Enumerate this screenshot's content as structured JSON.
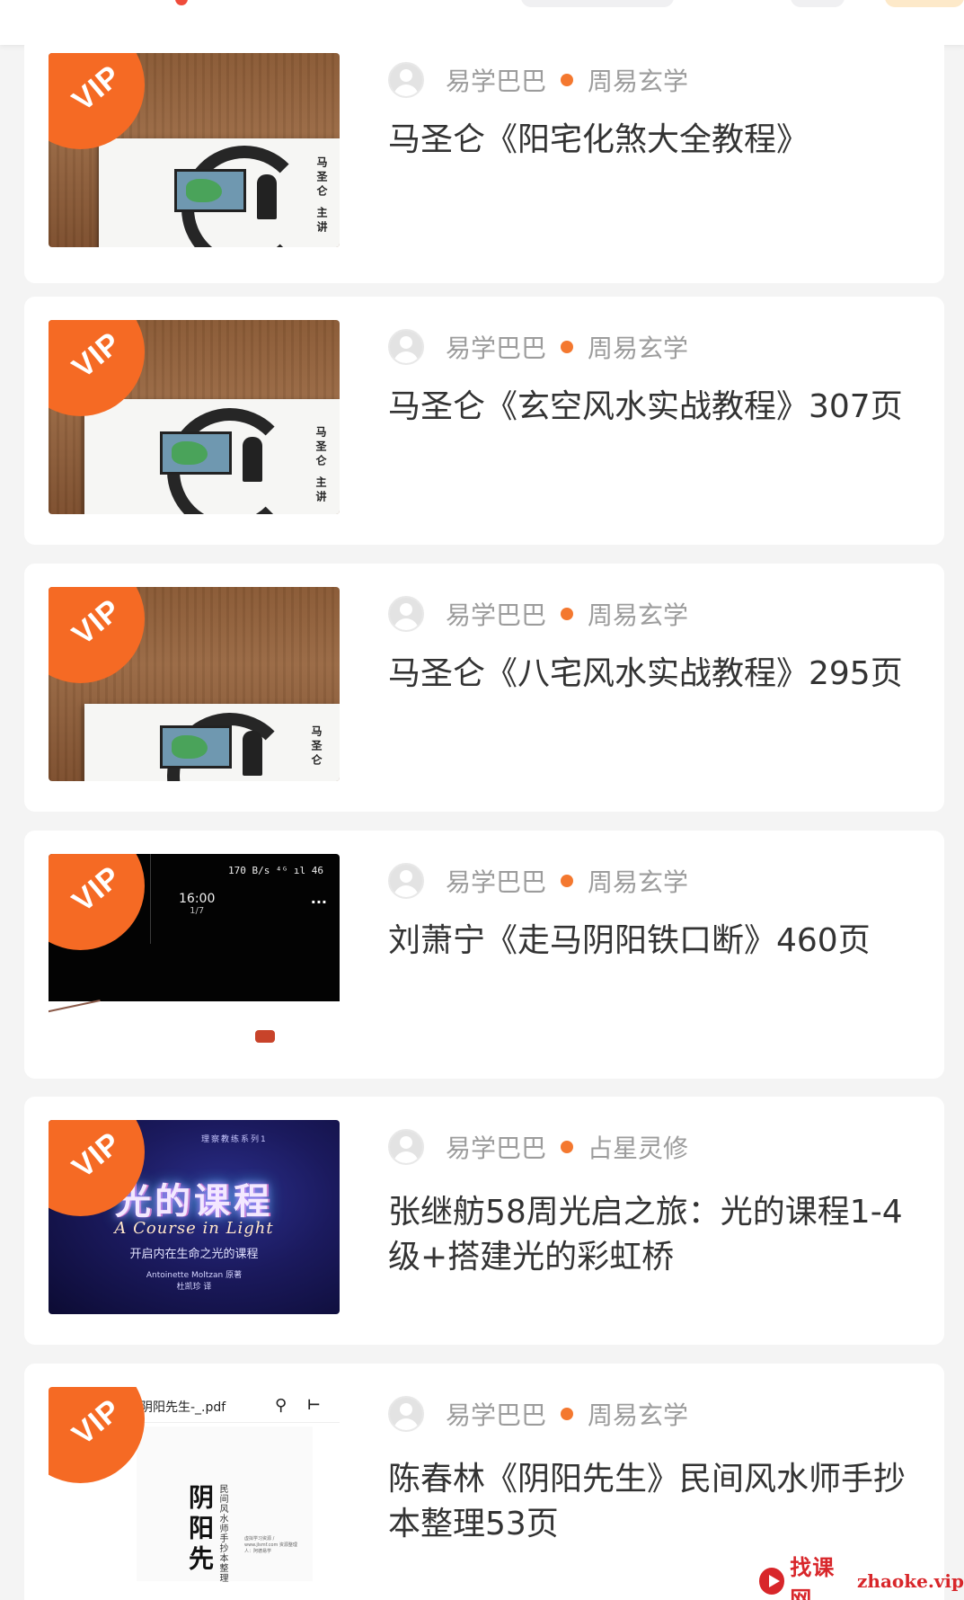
{
  "vip_label": "VIP",
  "cards": [
    {
      "author": "易学巴巴",
      "category": "周易玄学",
      "title": "马圣仑《阳宅化煞大全教程》",
      "cover": {
        "vertical_text": "马圣仑 主讲"
      }
    },
    {
      "author": "易学巴巴",
      "category": "周易玄学",
      "title": "马圣仑《玄空风水实战教程》307页",
      "cover": {
        "vertical_text": "马圣仑 主讲"
      }
    },
    {
      "author": "易学巴巴",
      "category": "周易玄学",
      "title": "马圣仑《八宅风水实战教程》295页",
      "cover": {
        "vertical_text": "马圣仑"
      }
    },
    {
      "author": "易学巴巴",
      "category": "周易玄学",
      "title": "刘萧宁《走马阴阳铁口断》460页",
      "cover": {
        "status": "170 B/s  ⁴ᴳ ıl 46",
        "time": "16:00",
        "page": "1/7",
        "menu": "···"
      }
    },
    {
      "author": "易学巴巴",
      "category": "占星灵修",
      "title": "张继舫58周光启之旅：光的课程1-4级+搭建光的彩虹桥",
      "cover": {
        "top": "理察教练系列1",
        "title": "光的课程",
        "en": "A Course in Light",
        "sub": "开启内在生命之光的课程",
        "author": "Antoinette Moltzan 原著",
        "translator": "杜凯珍 译"
      }
    },
    {
      "author": "易学巴巴",
      "category": "周易玄学",
      "title": "陈春林《阴阳先生》民间风水师手抄本整理53页",
      "cover": {
        "filename": "阴阳先生-_.pdf",
        "big": "阴阳先",
        "small": "民间风水师手抄本整理",
        "note": "虚拟学习资源 / www.jlsmf.com 资源整理人：阿德易学"
      }
    }
  ],
  "watermark": {
    "cn": "找课网",
    "en": "zhaoke.vip"
  },
  "colors": {
    "vip": "#f56a24",
    "dot": "#f4782f",
    "meta_text": "#9c9c9c",
    "title_text": "#333333",
    "background": "#f4f4f4"
  }
}
